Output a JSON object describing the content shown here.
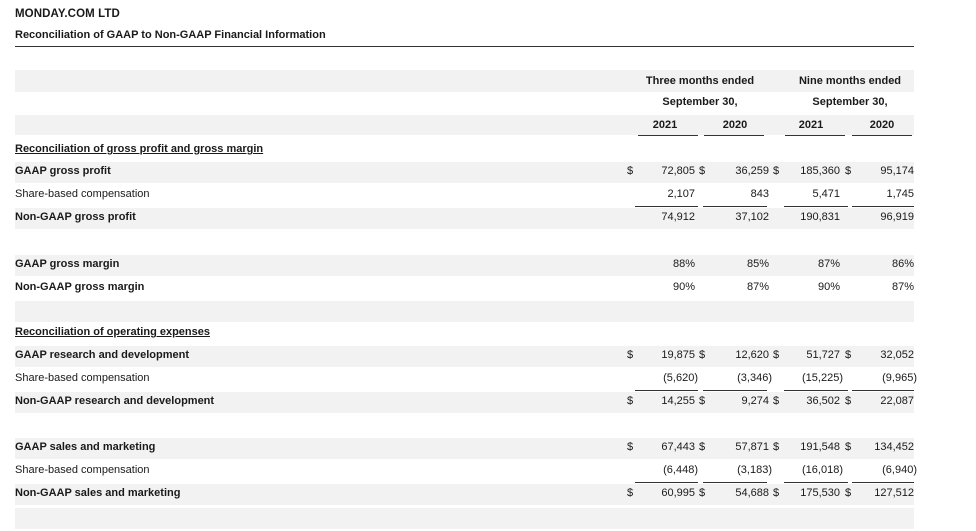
{
  "header": {
    "company": "MONDAY.COM LTD",
    "subtitle": "Reconciliation of GAAP to Non-GAAP Financial Information"
  },
  "columns": {
    "three_months_line1": "Three months ended",
    "three_months_line2": "September 30,",
    "nine_months_line1": "Nine months ended",
    "nine_months_line2": "September 30,",
    "years": [
      "2021",
      "2020",
      "2021",
      "2020"
    ]
  },
  "rows": [
    {
      "label": "Reconciliation of gross profit and gross margin",
      "style": "sec"
    },
    {
      "label": "GAAP gross profit",
      "style": "b",
      "lead": "$",
      "values": [
        "72,805",
        "36,259",
        "185,360",
        "95,174"
      ],
      "dollars": [
        true,
        true,
        true,
        false
      ]
    },
    {
      "label": "Share-based compensation",
      "style": "",
      "values": [
        "2,107",
        "843",
        "5,471",
        "1,745"
      ]
    },
    {
      "label": "Non-GAAP gross profit",
      "style": "b",
      "values": [
        "74,912",
        "37,102",
        "190,831",
        "96,919"
      ]
    },
    {
      "label": "",
      "style": ""
    },
    {
      "label": "GAAP gross margin",
      "style": "b",
      "values": [
        "88%",
        "85%",
        "87%",
        "86%"
      ]
    },
    {
      "label": "Non-GAAP gross margin",
      "style": "b",
      "values": [
        "90%",
        "87%",
        "90%",
        "87%"
      ]
    },
    {
      "label": "",
      "style": ""
    },
    {
      "label": "Reconciliation of operating expenses",
      "style": "sec"
    },
    {
      "label": "GAAP research and development",
      "style": "b",
      "lead": "$",
      "values": [
        "19,875",
        "12,620",
        "51,727",
        "32,052"
      ],
      "dollars": [
        true,
        true,
        true,
        false
      ]
    },
    {
      "label": "Share-based compensation",
      "style": "",
      "values": [
        "(5,620)",
        "(3,346)",
        "(15,225)",
        "(9,965)"
      ]
    },
    {
      "label": "Non-GAAP research and development",
      "style": "b",
      "lead": "$",
      "values": [
        "14,255",
        "9,274",
        "36,502",
        "22,087"
      ],
      "dollars": [
        true,
        true,
        true,
        false
      ]
    },
    {
      "label": "",
      "style": ""
    },
    {
      "label": "GAAP sales and marketing",
      "style": "b",
      "lead": "$",
      "values": [
        "67,443",
        "57,871",
        "191,548",
        "134,452"
      ],
      "dollars": [
        true,
        true,
        true,
        false
      ]
    },
    {
      "label": "Share-based compensation",
      "style": "",
      "values": [
        "(6,448)",
        "(3,183)",
        "(16,018)",
        "(6,940)"
      ]
    },
    {
      "label": "Non-GAAP sales and marketing",
      "style": "b",
      "lead": "$",
      "values": [
        "60,995",
        "54,688",
        "175,530",
        "127,512"
      ],
      "dollars": [
        true,
        true,
        true,
        false
      ]
    }
  ]
}
